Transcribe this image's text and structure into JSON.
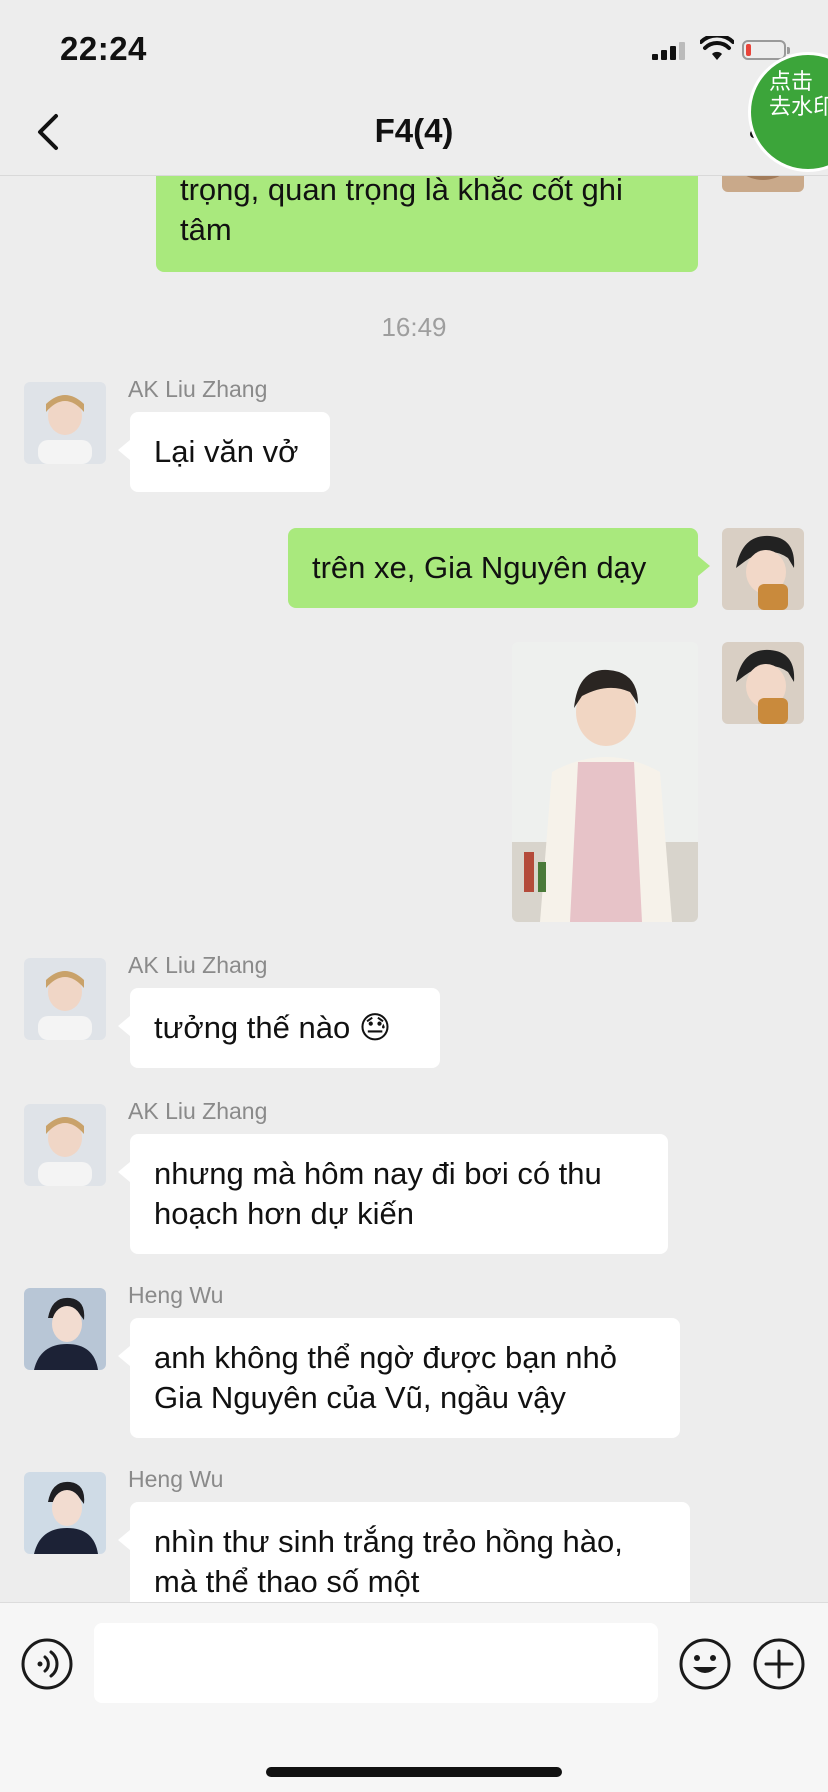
{
  "status_bar": {
    "time": "22:24"
  },
  "header": {
    "title": "F4(4)",
    "watermark_button": {
      "line1": "点击",
      "line2": "去水印"
    }
  },
  "messages": [
    {
      "type": "outgoing",
      "text": "trọng, quan trọng là khắc cốt ghi tâm"
    },
    {
      "type": "timestamp",
      "text": "16:49"
    },
    {
      "type": "incoming",
      "sender": "AK Liu Zhang",
      "text": "Lại văn vở"
    },
    {
      "type": "outgoing",
      "text": "trên xe, Gia Nguyên dạy"
    },
    {
      "type": "outgoing-image",
      "description_icon": "photo-of-person-in-apron"
    },
    {
      "type": "incoming",
      "sender": "AK Liu Zhang",
      "text": "tưởng thế nào 😓"
    },
    {
      "type": "incoming",
      "sender": "AK Liu Zhang",
      "text": "nhưng mà hôm nay đi bơi có thu hoạch hơn dự kiến"
    },
    {
      "type": "incoming",
      "sender": "Heng Wu",
      "text": "anh không thể ngờ được bạn nhỏ Gia Nguyên của Vũ, ngầu vậy"
    },
    {
      "type": "incoming",
      "sender": "Heng Wu",
      "text": "nhìn thư sinh trắng trẻo hồng hào, mà thể thao số một"
    }
  ],
  "input_bar": {
    "value": "",
    "placeholder": ""
  },
  "colors": {
    "outgoing_bubble": "#a9e97d",
    "incoming_bubble": "#ffffff",
    "background": "#ededed",
    "watermark_green": "#3ca53a"
  },
  "icons": [
    "back-icon",
    "more-icon",
    "voice-icon",
    "emoji-icon",
    "plus-icon"
  ]
}
